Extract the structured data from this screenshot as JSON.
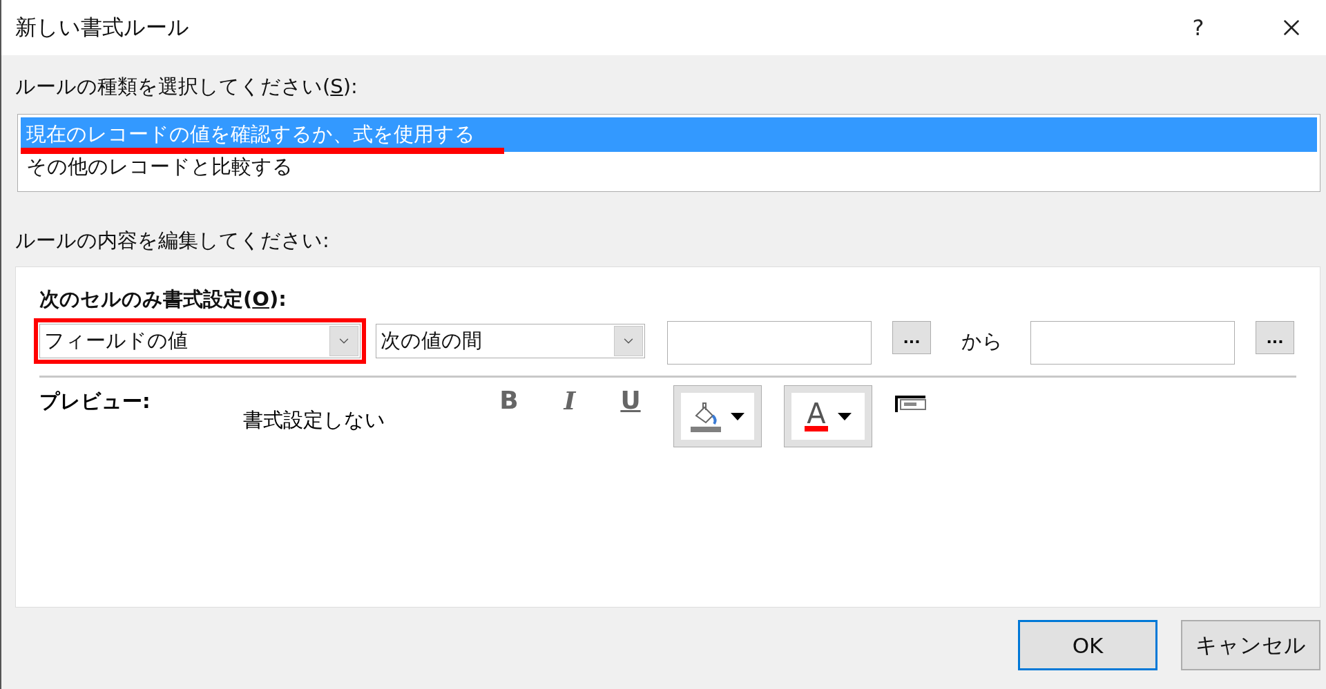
{
  "window": {
    "title": "新しい書式ルール",
    "help": "?"
  },
  "rule_type": {
    "label": {
      "text": "ルールの種類を選択してください(",
      "accelerator": "S",
      "suffix": "):"
    },
    "items": [
      {
        "label": "現在のレコードの値を確認するか、式を使用する",
        "selected": true,
        "marked": true
      },
      {
        "label": "その他のレコードと比較する",
        "selected": false,
        "marked": false
      }
    ]
  },
  "rule_edit": {
    "label": "ルールの内容を編集してください:",
    "condition_label": {
      "text": "次のセルのみ書式設定(",
      "accelerator": "O",
      "suffix": "):"
    },
    "field_dropdown": {
      "value": "フィールドの値",
      "marked": true
    },
    "operator_dropdown": {
      "value": "次の値の間",
      "marked": false
    },
    "builder_button": "...",
    "between_word": "から",
    "builder_button_2": "...",
    "preview_label": "プレビュー:",
    "preview_text": "書式設定しない",
    "style_buttons": [
      {
        "kind": "bold",
        "label": "B"
      },
      {
        "kind": "italic",
        "label": "I"
      },
      {
        "kind": "underline",
        "label": "U"
      }
    ],
    "font_color_glyph": "A"
  },
  "buttons": [
    {
      "label": "OK",
      "default": true
    },
    {
      "label": "キャンセル",
      "default": false
    }
  ]
}
